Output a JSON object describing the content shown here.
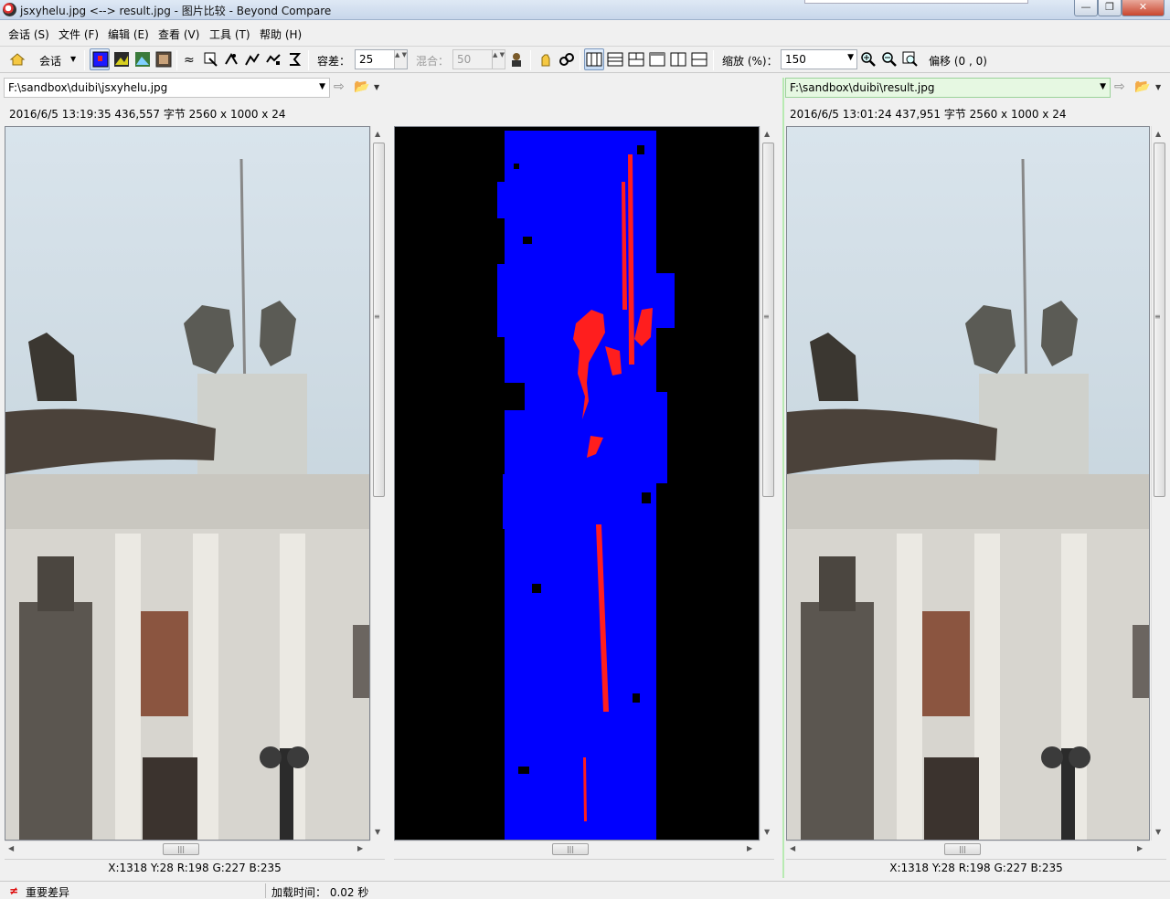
{
  "window": {
    "title": "jsxyhelu.jpg <--> result.jpg - 图片比较 - Beyond Compare",
    "min_glyph": "—",
    "max_glyph": "❐",
    "close_glyph": "✕"
  },
  "menu": [
    {
      "label": "会话 (S)"
    },
    {
      "label": "文件 (F)"
    },
    {
      "label": "编辑 (E)"
    },
    {
      "label": "查看 (V)"
    },
    {
      "label": "工具 (T)"
    },
    {
      "label": "帮助 (H)"
    }
  ],
  "toolbar": {
    "session_label": "会话",
    "tolerance_label": "容差：",
    "tolerance_value": "25",
    "blend_label": "混合：",
    "blend_value": "50",
    "zoom_label": "缩放 (%)：",
    "zoom_value": "150",
    "offset_label": "偏移 (0 , 0)"
  },
  "left": {
    "path": "F:\\sandbox\\duibi\\jsxyhelu.jpg",
    "info": "2016/6/5 13:19:35   436,557 字节   2560 x 1000 x 24",
    "pixel": "X:1318 Y:28 R:198 G:227 B:235"
  },
  "right": {
    "path": "F:\\sandbox\\duibi\\result.jpg",
    "info": "2016/6/5 13:01:24   437,951 字节   2560 x 1000 x 24",
    "pixel": "X:1318 Y:28 R:198 G:227 B:235"
  },
  "status": {
    "diff_label": "重要差异",
    "load_time": "加载时间： 0.02 秒"
  },
  "colors": {
    "diff_blue": "#0000ff",
    "diff_red": "#ff1e1e",
    "accent_green": "#b8eab2"
  },
  "glyphs": {
    "arrow_up": "▲",
    "arrow_down": "▼",
    "arrow_left": "◀",
    "arrow_right": "▶",
    "grip_v": "≡",
    "grip_h": "|||",
    "dropdown": "▼",
    "spin_arrows": "▲ ▼",
    "forward_arrow": "⇨",
    "folder": "📂",
    "diff_mark": "≠"
  }
}
